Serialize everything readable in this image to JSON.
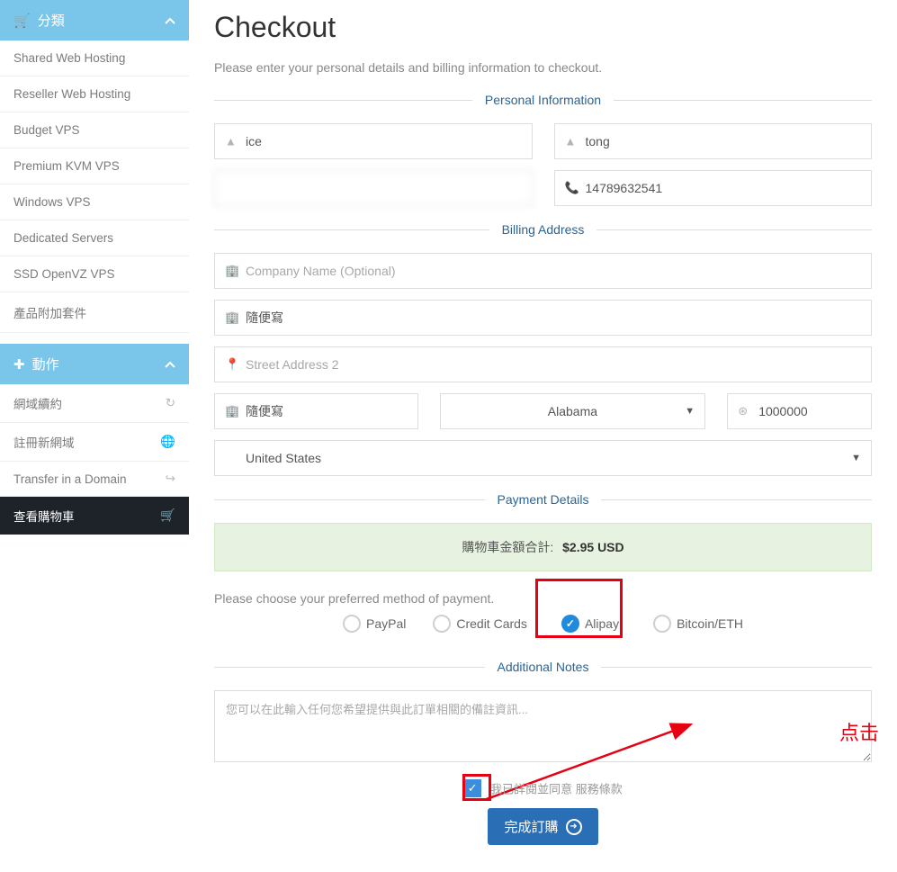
{
  "sidebar": {
    "categories": {
      "header": "分類",
      "items": [
        "Shared Web Hosting",
        "Reseller Web Hosting",
        "Budget VPS",
        "Premium KVM VPS",
        "Windows VPS",
        "Dedicated Servers",
        "SSD OpenVZ VPS",
        "產品附加套件"
      ]
    },
    "actions": {
      "header": "動作",
      "items": [
        "網域續約",
        "註冊新網域",
        "Transfer in a Domain",
        "查看購物車"
      ]
    }
  },
  "page": {
    "title": "Checkout",
    "subtitle": "Please enter your personal details and billing information to checkout."
  },
  "sections": {
    "personal": "Personal Information",
    "billing": "Billing Address",
    "payment": "Payment Details",
    "notes": "Additional Notes"
  },
  "form": {
    "first_name": "ice",
    "last_name": "tong",
    "email": "",
    "phone": "14789632541",
    "company_placeholder": "Company Name (Optional)",
    "street1": "隨便寫",
    "street2_placeholder": "Street Address 2",
    "city": "隨便寫",
    "state": "Alabama",
    "zip": "1000000",
    "country": "United States"
  },
  "payment": {
    "total_label": "購物車金額合計:",
    "total_value": "$2.95 USD",
    "choose_label": "Please choose your preferred method of payment.",
    "options": [
      "PayPal",
      "Credit Cards",
      "Alipay",
      "Bitcoin/ETH"
    ],
    "selected": "Alipay"
  },
  "notes": {
    "placeholder": "您可以在此輸入任何您希望提供與此訂單相關的備註資訊..."
  },
  "tos": {
    "text": "我已詳閱並同意 服務條款"
  },
  "submit": {
    "label": "完成訂購"
  },
  "annotation": {
    "click": "点击"
  }
}
